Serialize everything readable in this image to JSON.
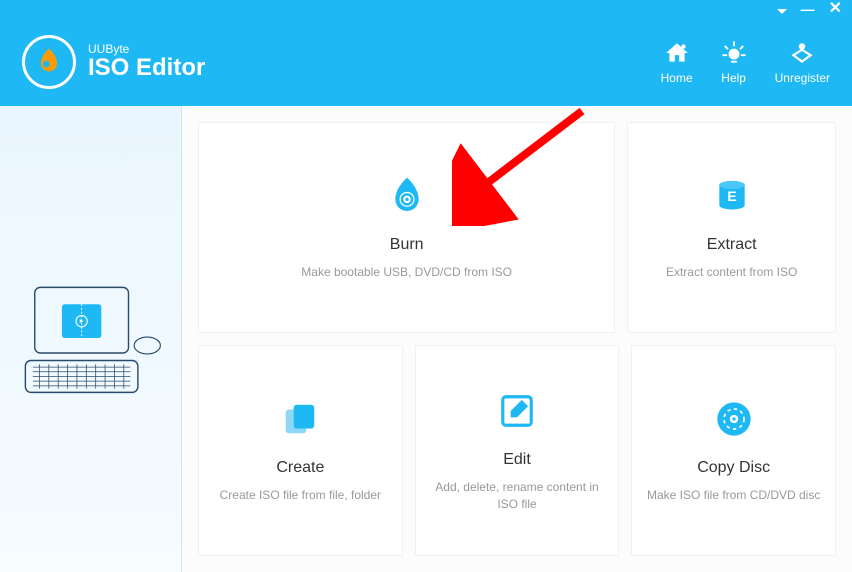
{
  "app": {
    "publisher": "UUByte",
    "title": "ISO Editor"
  },
  "nav": {
    "home": "Home",
    "help": "Help",
    "unregister": "Unregister"
  },
  "cards": {
    "burn": {
      "title": "Burn",
      "desc": "Make bootable USB, DVD/CD from ISO"
    },
    "extract": {
      "title": "Extract",
      "desc": "Extract content from ISO"
    },
    "create": {
      "title": "Create",
      "desc": "Create ISO file from file, folder"
    },
    "edit": {
      "title": "Edit",
      "desc": "Add, delete, rename content in ISO file"
    },
    "copydisc": {
      "title": "Copy Disc",
      "desc": "Make ISO file from CD/DVD disc"
    }
  },
  "colors": {
    "primary": "#1eb8f5",
    "accentOrange": "#ff9b00",
    "arrowRed": "#ff0000"
  }
}
